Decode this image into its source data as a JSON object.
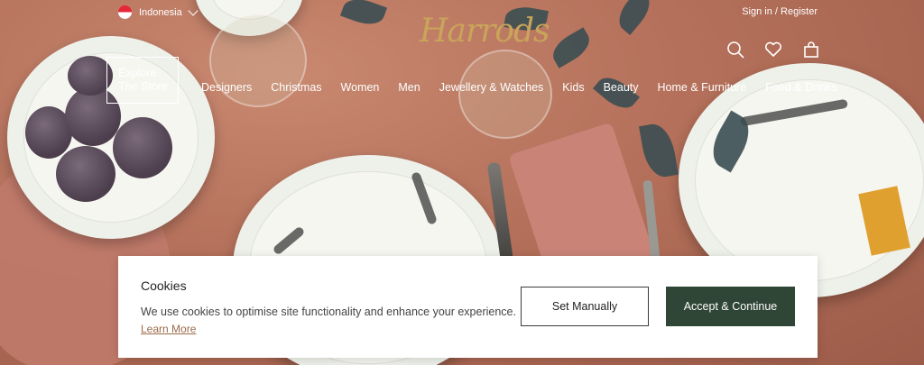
{
  "header": {
    "country": "Indonesia",
    "sign_in": "Sign in",
    "separator": "/",
    "register": "Register",
    "logo_text": "Harrods",
    "icons": [
      "search-icon",
      "heart-icon",
      "shopping-bag-icon"
    ]
  },
  "explore": {
    "line1": "Explore",
    "line2": "The Store"
  },
  "nav": {
    "items": [
      "Designers",
      "Christmas",
      "Women",
      "Men",
      "Jewellery & Watches",
      "Kids",
      "Beauty",
      "Home & Furniture",
      "Food & Drinks"
    ]
  },
  "cookie": {
    "title": "Cookies",
    "text": "We use cookies to optimise site functionality and enhance your experience.",
    "learn_more": "Learn More",
    "set_manually": "Set Manually",
    "accept": "Accept & Continue"
  },
  "colors": {
    "brand_gold": "#c9a45a",
    "accept_green": "#2f4535",
    "link_brown": "#9a6a48"
  }
}
